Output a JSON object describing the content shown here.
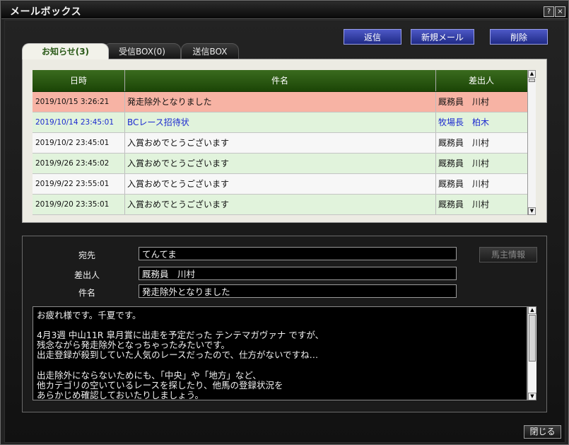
{
  "window": {
    "title": "メールボックス",
    "help_glyph": "?",
    "close_glyph": "×"
  },
  "toolbar": {
    "reply_label": "返信",
    "new_label": "新規メール",
    "delete_label": "削除"
  },
  "tabs": [
    {
      "label": "お知らせ(3)",
      "active": true
    },
    {
      "label": "受信BOX(0)",
      "active": false
    },
    {
      "label": "送信BOX",
      "active": false
    }
  ],
  "mail_list": {
    "columns": [
      "日時",
      "件名",
      "差出人"
    ],
    "rows": [
      {
        "date": "2019/10/15 3:26:21",
        "subject": "発走除外となりました",
        "from": "厩務員　川村",
        "state": "selected"
      },
      {
        "date": "2019/10/14 23:45:01",
        "subject": "BCレース招待状",
        "from": "牧場長　柏木",
        "state": "unread"
      },
      {
        "date": "2019/10/2 23:45:01",
        "subject": "入賞おめでとうございます",
        "from": "厩務員　川村",
        "state": "read"
      },
      {
        "date": "2019/9/26 23:45:02",
        "subject": "入賞おめでとうございます",
        "from": "厩務員　川村",
        "state": "read"
      },
      {
        "date": "2019/9/22 23:55:01",
        "subject": "入賞おめでとうございます",
        "from": "厩務員　川村",
        "state": "read"
      },
      {
        "date": "2019/9/20 23:35:01",
        "subject": "入賞おめでとうございます",
        "from": "厩務員　川村",
        "state": "read"
      }
    ]
  },
  "detail": {
    "to_label": "宛先",
    "to_value": "てんてま",
    "from_label": "差出人",
    "from_value": "厩務員　川村",
    "subject_label": "件名",
    "subject_value": "発走除外となりました",
    "owner_info_label": "馬主情報",
    "body_lines": [
      "お疲れ様です。千夏です。",
      "",
      "4月3週 中山11R 皐月賞に出走を予定だった テンテマガヴァナ ですが、",
      "残念ながら発走除外となっちゃったみたいです。",
      "出走登録が殺到していた人気のレースだったので、仕方がないですね…",
      "",
      "出走除外にならないためにも、「中央」や「地方」など、",
      "他カテゴリの空いているレースを探したり、他馬の登録状況を",
      "あらかじめ確認しておいたりしましょう。"
    ]
  },
  "footer": {
    "close_label": "閉じる"
  },
  "colors": {
    "selected_row": "#f7b3a4",
    "read_row": "#e1f3dc",
    "unread_text": "#1c2ad0",
    "header_green": "#2b5a12",
    "button_blue": "#3641a8"
  }
}
